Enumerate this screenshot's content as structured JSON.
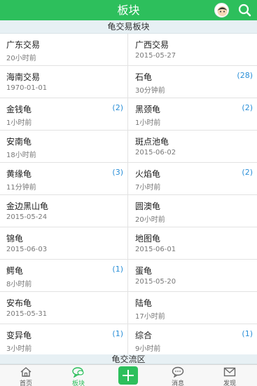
{
  "header": {
    "title": "板块"
  },
  "section_top": "龟交易板块",
  "section_bottom": "龟交流区",
  "boards": [
    {
      "left": {
        "name": "广东交易",
        "time": "20小时前",
        "count": ""
      },
      "right": {
        "name": "广西交易",
        "time": "2015-05-27",
        "count": ""
      }
    },
    {
      "left": {
        "name": "海南交易",
        "time": "1970-01-01",
        "count": ""
      },
      "right": {
        "name": "石龟",
        "time": "30分钟前",
        "count": "(28)"
      }
    },
    {
      "left": {
        "name": "金钱龟",
        "time": "1小时前",
        "count": "(2)"
      },
      "right": {
        "name": "黑颈龟",
        "time": "1小时前",
        "count": "(2)"
      }
    },
    {
      "left": {
        "name": "安南龟",
        "time": "18小时前",
        "count": ""
      },
      "right": {
        "name": "斑点池龟",
        "time": "2015-06-02",
        "count": ""
      }
    },
    {
      "left": {
        "name": "黄缘龟",
        "time": "11分钟前",
        "count": "(3)"
      },
      "right": {
        "name": "火焰龟",
        "time": "7小时前",
        "count": "(2)"
      }
    },
    {
      "left": {
        "name": "金边黑山龟",
        "time": "2015-05-24",
        "count": ""
      },
      "right": {
        "name": "圆澳龟",
        "time": "20小时前",
        "count": ""
      }
    },
    {
      "left": {
        "name": "锦龟",
        "time": "2015-06-03",
        "count": ""
      },
      "right": {
        "name": "地图龟",
        "time": "2015-06-01",
        "count": ""
      }
    },
    {
      "left": {
        "name": "鳄龟",
        "time": "8小时前",
        "count": "(1)"
      },
      "right": {
        "name": "蛋龟",
        "time": "2015-05-20",
        "count": ""
      }
    },
    {
      "left": {
        "name": "安布龟",
        "time": "2015-05-31",
        "count": ""
      },
      "right": {
        "name": "陆龟",
        "time": "17小时前",
        "count": ""
      }
    },
    {
      "left": {
        "name": "变异龟",
        "time": "3小时前",
        "count": "(1)"
      },
      "right": {
        "name": "综合",
        "time": "9小时前",
        "count": "(1)"
      }
    }
  ],
  "tabs": {
    "home": "首页",
    "boards": "板块",
    "messages": "消息",
    "discover": "发现"
  },
  "icons": {
    "avatar": "avatar-icon",
    "search": "search-icon",
    "post": "plus-icon"
  },
  "colors": {
    "brand": "#2dbf5c",
    "count": "#2a8fd8"
  }
}
